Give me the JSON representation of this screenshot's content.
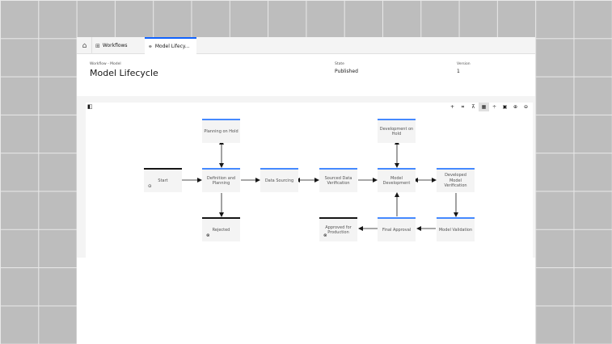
{
  "tabs": {
    "home_icon": "home-icon",
    "items": [
      {
        "icon": "table-icon",
        "label": "Workflows"
      },
      {
        "icon": "workflow-icon",
        "label": "Model Lifecy..."
      }
    ]
  },
  "header": {
    "breadcrumb": "Workflow - Model",
    "title": "Model Lifecycle",
    "state_label": "State",
    "state_value": "Published",
    "version_label": "Version",
    "version_value": "1"
  },
  "toolbar": {
    "left_icon": "side-panel-icon",
    "buttons": [
      {
        "icon": "add-icon",
        "glyph": "+"
      },
      {
        "icon": "connect-icon",
        "glyph": "⌗"
      },
      {
        "icon": "center-icon",
        "glyph": "⊼"
      },
      {
        "icon": "grid-icon",
        "glyph": "▦",
        "active": true
      },
      {
        "icon": "fit-icon",
        "glyph": "÷"
      },
      {
        "icon": "minimap-icon",
        "glyph": "▣"
      },
      {
        "icon": "zoom-in-icon",
        "glyph": "⊕"
      },
      {
        "icon": "zoom-out-icon",
        "glyph": "⊖"
      }
    ]
  },
  "diagram": {
    "nodes": {
      "start": {
        "label": "Start",
        "icon": "play-icon",
        "glyph": "⊙"
      },
      "definition": {
        "label": "Definition and Planning"
      },
      "planning_hold": {
        "label": "Planning on Hold"
      },
      "rejected": {
        "label": "Rejected",
        "icon": "stop-icon",
        "glyph": "⊗"
      },
      "data_sourcing": {
        "label": "Data Sourcing"
      },
      "sourced_verification": {
        "label": "Sourced Data Verification"
      },
      "model_development": {
        "label": "Model Development"
      },
      "development_hold": {
        "label": "Development on Hold"
      },
      "developed_verification": {
        "label": "Developed Model Verification"
      },
      "model_validation": {
        "label": "Model Validation"
      },
      "final_approval": {
        "label": "Final Approval"
      },
      "approved_production": {
        "label": "Approved for Production",
        "icon": "stop-icon",
        "glyph": "⊗"
      }
    }
  }
}
